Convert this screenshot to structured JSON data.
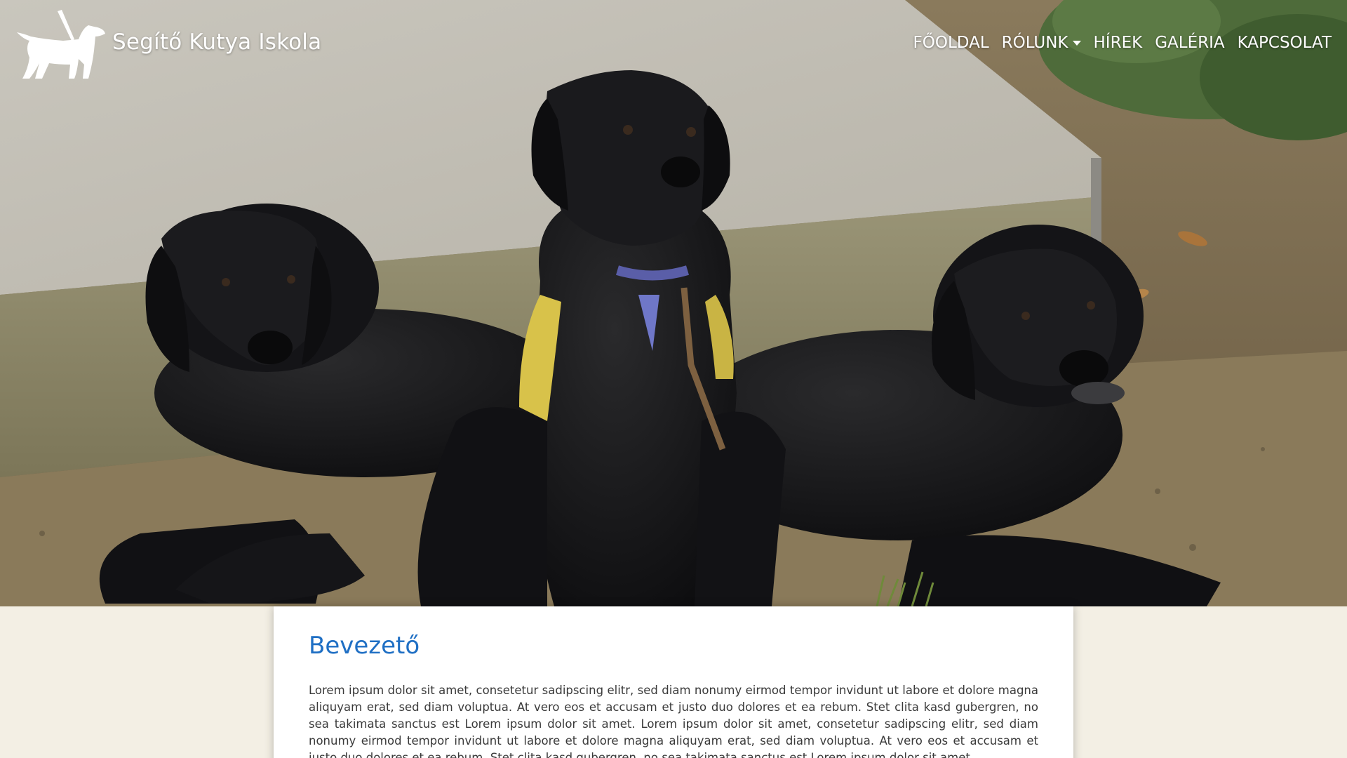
{
  "brand": {
    "name": "Segítő Kutya Iskola",
    "logo_icon": "guide-dog-logo-icon"
  },
  "nav": {
    "items": [
      {
        "label": "FŐOLDAL",
        "has_dropdown": false
      },
      {
        "label": "RÓLUNK",
        "has_dropdown": true
      },
      {
        "label": "HÍREK",
        "has_dropdown": false
      },
      {
        "label": "GALÉRIA",
        "has_dropdown": false
      },
      {
        "label": "KAPCSOLAT",
        "has_dropdown": false
      }
    ]
  },
  "hero": {
    "image": "three-black-labradors-photo"
  },
  "intro": {
    "title": "Bevezető",
    "text": "Lorem ipsum dolor sit amet, consetetur sadipscing elitr, sed diam nonumy eirmod tempor invidunt ut labore et dolore magna aliquyam erat, sed diam voluptua. At vero eos et accusam et justo duo dolores et ea rebum. Stet clita kasd gubergren, no sea takimata sanctus est Lorem ipsum dolor sit amet. Lorem ipsum dolor sit amet, consetetur sadipscing elitr, sed diam nonumy eirmod tempor invidunt ut labore et dolore magna aliquyam erat, sed diam voluptua. At vero eos et accusam et justo duo dolores et ea rebum. Stet clita kasd gubergren, no sea takimata sanctus est Lorem ipsum dolor sit amet."
  },
  "colors": {
    "accent": "#1f6fc4",
    "page_background": "#f3efe4",
    "nav_text": "#ffffff"
  }
}
